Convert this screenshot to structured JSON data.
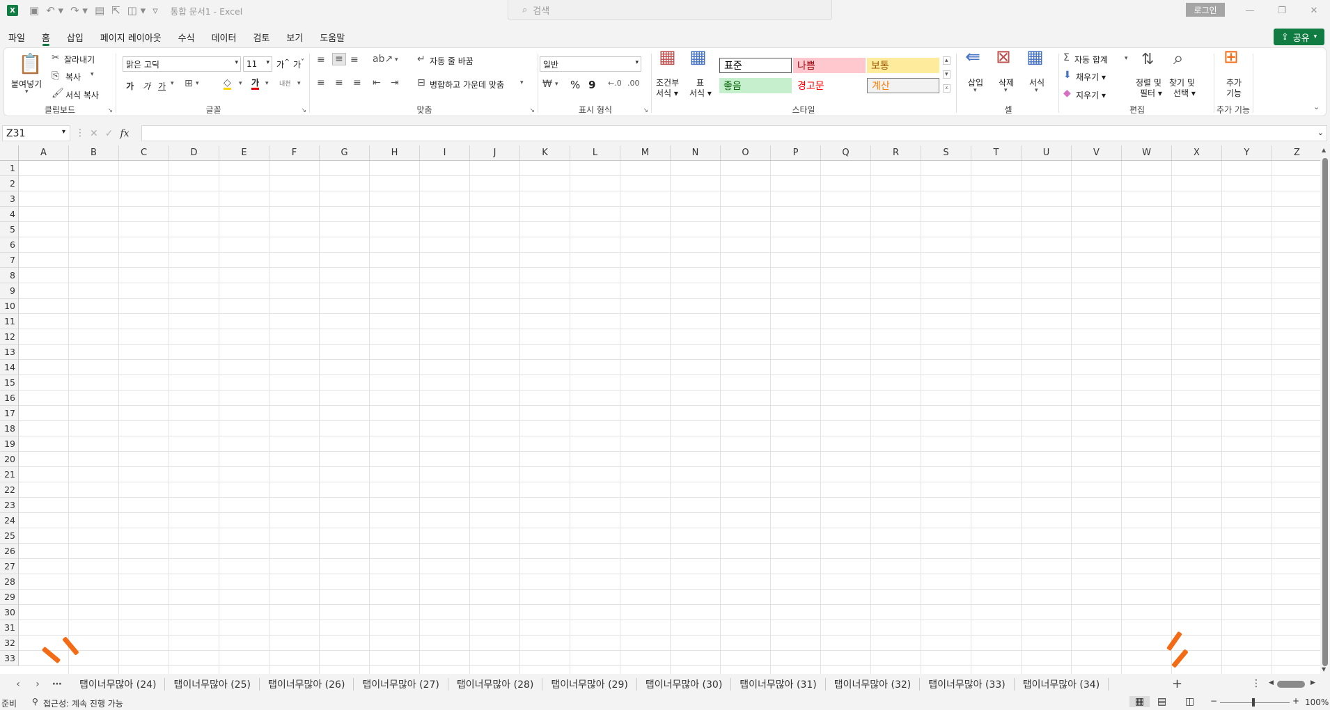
{
  "titlebar": {
    "logo": "X",
    "doc_title": "통합 문서1  -  Excel",
    "search_placeholder": "검색",
    "login_label": "로그인",
    "icons": [
      "save-icon",
      "undo-icon",
      "redo-icon",
      "form-icon",
      "select-icon",
      "camera-icon",
      "customize-icon"
    ]
  },
  "menu": {
    "tabs": [
      "파일",
      "홈",
      "삽입",
      "페이지 레이아웃",
      "수식",
      "데이터",
      "검토",
      "보기",
      "도움말"
    ],
    "active": "홈",
    "share_label": "공유"
  },
  "ribbon": {
    "clipboard": {
      "paste": "붙여넣기",
      "cut": "잘라내기",
      "copy": "복사",
      "format_painter": "서식 복사",
      "label": "클립보드"
    },
    "font": {
      "name": "맑은 고딕",
      "size": "11",
      "grow": "가",
      "shrink": "가",
      "bold": "가",
      "italic": "가",
      "underline": "가",
      "font_color": "가",
      "phonetic": "내천",
      "label": "글꼴"
    },
    "alignment": {
      "wrap": "자동 줄 바꿈",
      "merge": "병합하고 가운데 맞춤",
      "label": "맞춤"
    },
    "number": {
      "format": "일반",
      "percent": "%",
      "comma": "9",
      "label": "표시 형식"
    },
    "styles": {
      "conditional_1": "조건부",
      "conditional_2": "서식",
      "table_1": "표",
      "table_2": "서식",
      "normal": "표준",
      "bad": "나쁨",
      "neutral": "보통",
      "good": "좋음",
      "warning": "경고문",
      "calc": "계산",
      "label": "스타일"
    },
    "cells": {
      "insert": "삽입",
      "delete": "삭제",
      "format": "서식",
      "label": "셀"
    },
    "editing": {
      "autosum": "자동 합계",
      "fill": "채우기",
      "clear": "지우기",
      "sort_1": "정렬 및",
      "sort_2": "필터",
      "find_1": "찾기 및",
      "find_2": "선택",
      "label": "편집"
    },
    "addins": {
      "line1": "추가",
      "line2": "기능",
      "label": "추가 기능"
    }
  },
  "formula_bar": {
    "name_box": "Z31",
    "fx": "fx",
    "value": ""
  },
  "grid": {
    "columns": [
      "A",
      "B",
      "C",
      "D",
      "E",
      "F",
      "G",
      "H",
      "I",
      "J",
      "K",
      "L",
      "M",
      "N",
      "O",
      "P",
      "Q",
      "R",
      "S",
      "T",
      "U",
      "V",
      "W",
      "X",
      "Y",
      "Z"
    ],
    "rows": [
      "1",
      "2",
      "3",
      "4",
      "5",
      "6",
      "7",
      "8",
      "9",
      "10",
      "11",
      "12",
      "13",
      "14",
      "15",
      "16",
      "17",
      "18",
      "19",
      "20",
      "21",
      "22",
      "23",
      "24",
      "25",
      "26",
      "27",
      "28",
      "29",
      "30",
      "31",
      "32",
      "33"
    ]
  },
  "sheets": {
    "more": "⋯",
    "tabs": [
      "탭이너무많아 (24)",
      "탭이너무많아 (25)",
      "탭이너무많아 (26)",
      "탭이너무많아 (27)",
      "탭이너무많아 (28)",
      "탭이너무많아 (29)",
      "탭이너무많아 (30)",
      "탭이너무많아 (31)",
      "탭이너무많아 (32)",
      "탭이너무많아 (33)",
      "탭이너무많아 (34)"
    ],
    "add": "+"
  },
  "status": {
    "ready": "준비",
    "accessibility": "접근성: 계속 진행 가능",
    "zoom": "100%"
  },
  "colors": {
    "accent": "#107c41",
    "marker": "#f36b14"
  }
}
